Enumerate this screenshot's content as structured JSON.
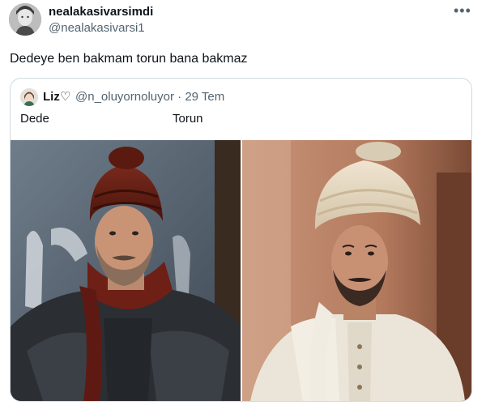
{
  "author": {
    "display_name": "nealakasivarsimdi",
    "handle": "@nealakasivarsi1"
  },
  "menu": {
    "more_label": "•••"
  },
  "tweet": {
    "text": "Dedeye ben bakmam torun bana bakmaz"
  },
  "quote": {
    "name": "Liz",
    "name_suffix": "♡",
    "handle": "@n_oluyornoluyor",
    "separator": "·",
    "date": "29 Tem",
    "label_left": "Dede",
    "label_right": "Torun"
  },
  "colors": {
    "text_primary": "#0f1419",
    "text_secondary": "#536471",
    "border": "#cfd9de"
  },
  "icons": {
    "author_avatar": "portrait-avatar",
    "quote_avatar": "portrait-avatar-small",
    "more": "more-horizontal-icon",
    "heart": "heart-outline-icon"
  }
}
